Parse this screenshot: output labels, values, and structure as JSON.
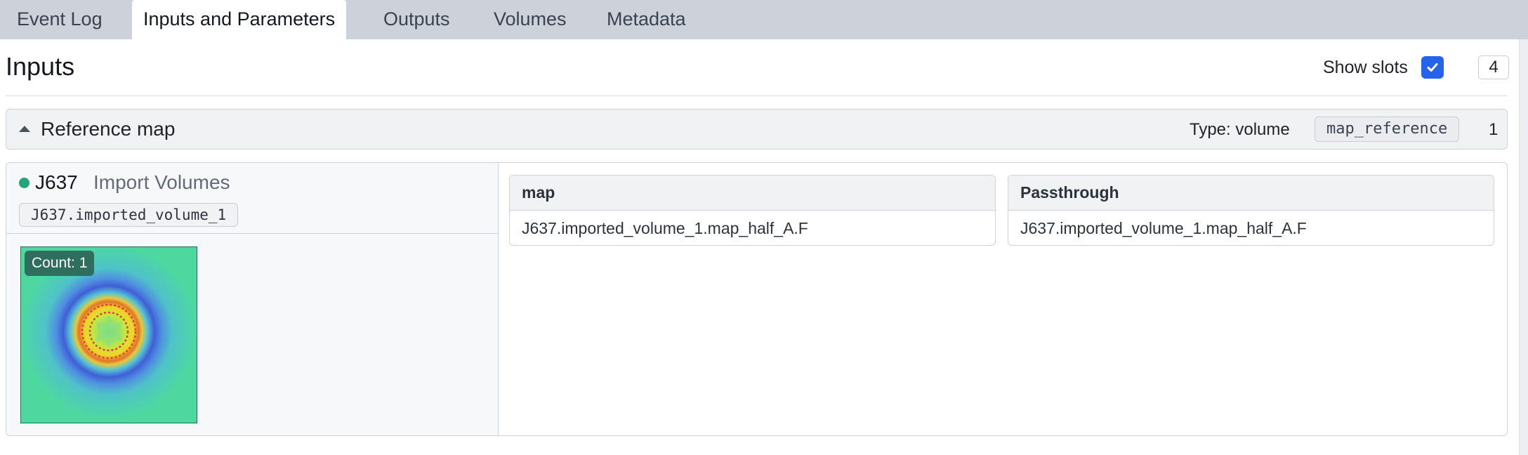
{
  "tabs": [
    {
      "label": "Event Log",
      "active": false
    },
    {
      "label": "Inputs and Parameters",
      "active": true
    },
    {
      "label": "Outputs",
      "active": false
    },
    {
      "label": "Volumes",
      "active": false
    },
    {
      "label": "Metadata",
      "active": false
    }
  ],
  "header": {
    "title": "Inputs",
    "show_slots_label": "Show slots",
    "show_slots_checked": true,
    "count": "4"
  },
  "section": {
    "title": "Reference map",
    "type_label": "Type: volume",
    "type_code": "map_reference",
    "slot_count": "1"
  },
  "input_job": {
    "status_color": "#22a57a",
    "job_id": "J637",
    "job_type": "Import Volumes",
    "output_name": "J637.imported_volume_1",
    "thumbnail_count_label": "Count: 1"
  },
  "slots": [
    {
      "header": "map",
      "value": "J637.imported_volume_1.map_half_A.F"
    },
    {
      "header": "Passthrough",
      "value": "J637.imported_volume_1.map_half_A.F"
    }
  ],
  "colors": {
    "accent": "#2563eb",
    "tab_bar": "#cdd1d9",
    "badge": "#2f6e5d"
  }
}
